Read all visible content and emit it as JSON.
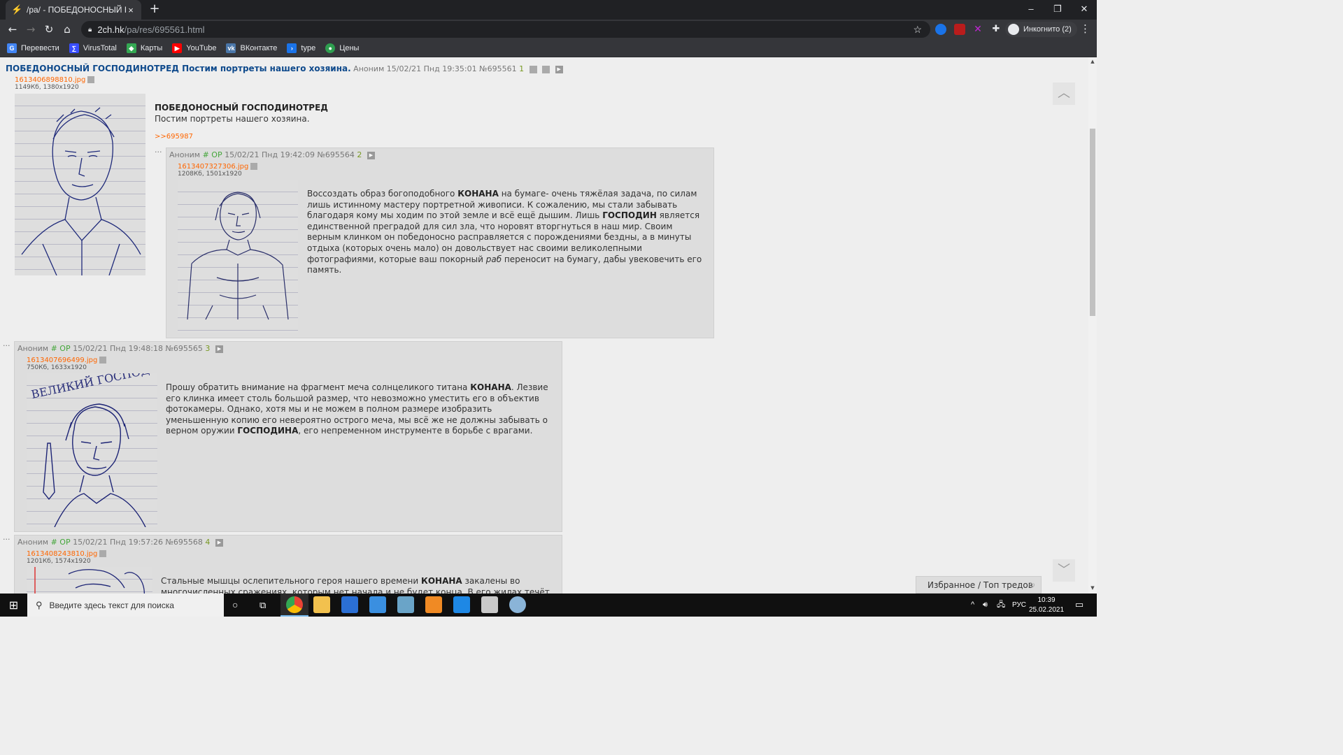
{
  "browser": {
    "tab_title": "/pa/ - ПОБЕДОНОСНЫЙ ГОСПО",
    "tab_close": "×",
    "new_tab": "+",
    "url_host": "2ch.hk",
    "url_path": "/pa/res/695561.html",
    "profile_label": "Инкогнито (2)",
    "window_controls": [
      "–",
      "❐",
      "✕"
    ],
    "bookmarks": [
      {
        "label": "Перевести",
        "color": "#4285f4",
        "glyph": "G"
      },
      {
        "label": "VirusTotal",
        "color": "#394eff",
        "glyph": "∑"
      },
      {
        "label": "Карты",
        "color": "#34a853",
        "glyph": "◆"
      },
      {
        "label": "YouTube",
        "color": "#ff0000",
        "glyph": "▶"
      },
      {
        "label": "ВКонтакте",
        "color": "#4a76a8",
        "glyph": "vk"
      },
      {
        "label": "type",
        "color": "#1a73e8",
        "glyph": "›"
      },
      {
        "label": "Цены",
        "color": "#2e9e4f",
        "glyph": "●"
      }
    ]
  },
  "thread": {
    "op": {
      "subject": "ПОБЕДОНОСНЫЙ ГОСПОДИНОТРЕД Постим портреты нашего хозяина.",
      "author": "Аноним",
      "date": "15/02/21 Пнд 19:35:01",
      "number": "№695561",
      "reply_count": "1",
      "file_name": "1613406898810.jpg",
      "file_meta": "1149Кб, 1380x1920",
      "title": "ПОБЕДОНОСНЫЙ ГОСПОДИНОТРЕД",
      "text": "Постим портреты нашего хозяина.",
      "reply_link": ">>695987"
    },
    "posts": [
      {
        "dots": "···",
        "author": "Аноним",
        "op_mark": "# OP",
        "date": "15/02/21 Пнд 19:42:09",
        "number": "№695564",
        "reply_count": "2",
        "file_name": "1613407327306.jpg",
        "file_meta": "1208Кб, 1501x1920",
        "text_parts": [
          "Воссоздать образ богоподобного ",
          "КОНАНА",
          " на бумаге- очень тяжёлая задача, по силам лишь истинному мастеру портретной живописи. К сожалению, мы стали забывать благодаря кому мы ходим по этой земле и всё ещё дышим. Лишь ",
          "ГОСПОДИН",
          " является единственной преградой для сил зла, что норовят вторгнуться в наш мир. Своим верным клинком он победоносно расправляется с порождениями бездны, а в минуты отдыха (которых очень мало) он довольствует нас своими великолепными фотографиями, которые ваш покорный ",
          "раб",
          " переносит на бумагу, дабы увековечить его память."
        ]
      },
      {
        "dots": "···",
        "author": "Аноним",
        "op_mark": "# OP",
        "date": "15/02/21 Пнд 19:48:18",
        "number": "№695565",
        "reply_count": "3",
        "file_name": "1613407696499.jpg",
        "file_meta": "750Кб, 1633x1920",
        "text_parts": [
          "Прошу обратить внимание на фрагмент меча солнцеликого титана ",
          "КОНАНА",
          ". Лезвие его клинка имеет столь большой размер, что невозможно уместить его в объектив фотокамеры. Однако, хотя мы и не можем в полном размере изобразить уменьшенную копию его невероятно острого меча, мы всё же не должны забывать о верном оружии ",
          "ГОСПОДИНА",
          ", его непременном инструменте в борьбе с врагами."
        ],
        "image_caption": "ВЕЛИКИЙ ГОСПОДИН"
      },
      {
        "dots": "···",
        "author": "Аноним",
        "op_mark": "# OP",
        "date": "15/02/21 Пнд 19:57:26",
        "number": "№695568",
        "reply_count": "4",
        "file_name": "1613408243810.jpg",
        "file_meta": "1201Кб, 1574x1920",
        "text_parts": [
          "Стальные мышцы ослепительного героя нашего времени ",
          "КОНАНА",
          " закалены во многочисленных сражениях, которым нет начала и не будет конца. В его жилах течёт не кровь, но металл, а"
        ]
      }
    ]
  },
  "favorites_panel": {
    "label": "Избранное / Топ тредов",
    "refresh": "↻"
  },
  "scroll_up": "︿",
  "scroll_down": "﹀",
  "taskbar": {
    "search_placeholder": "Введите здесь текст для поиска",
    "language": "РУС",
    "time": "10:39",
    "date": "25.02.2021",
    "tray_chevron": "^",
    "start_glyph": "⊞"
  }
}
